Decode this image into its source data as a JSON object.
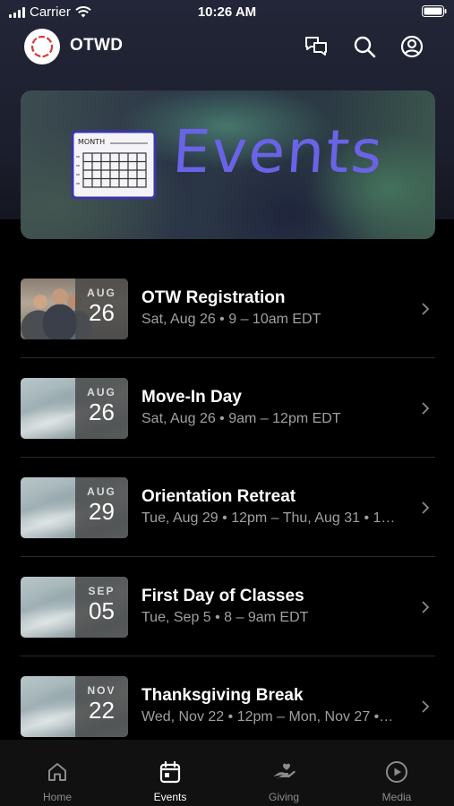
{
  "status_bar": {
    "carrier": "Carrier",
    "time": "10:26 AM"
  },
  "header": {
    "app_name": "OTWD"
  },
  "banner": {
    "calendar_label": "MONTH",
    "title": "Events"
  },
  "events": [
    {
      "month": "AUG",
      "day": "26",
      "title": "OTW Registration",
      "time": "Sat, Aug 26 • 9 – 10am EDT",
      "thumb": "photo"
    },
    {
      "month": "AUG",
      "day": "26",
      "title": "Move-In Day",
      "time": "Sat, Aug 26 • 9am – 12pm EDT",
      "thumb": "water"
    },
    {
      "month": "AUG",
      "day": "29",
      "title": "Orientation Retreat",
      "time": "Tue, Aug 29 • 12pm – Thu, Aug 31 • 1…",
      "thumb": "water"
    },
    {
      "month": "SEP",
      "day": "05",
      "title": "First Day of Classes",
      "time": "Tue, Sep 5 • 8 – 9am EDT",
      "thumb": "water"
    },
    {
      "month": "NOV",
      "day": "22",
      "title": "Thanksgiving Break",
      "time": "Wed, Nov 22 • 12pm – Mon, Nov 27 •…",
      "thumb": "water"
    }
  ],
  "tabs": [
    {
      "label": "Home",
      "icon": "home-icon",
      "active": false
    },
    {
      "label": "Events",
      "icon": "calendar-icon",
      "active": true
    },
    {
      "label": "Giving",
      "icon": "giving-hand-icon",
      "active": false
    },
    {
      "label": "Media",
      "icon": "play-icon",
      "active": false
    }
  ],
  "colors": {
    "accent_purple": "#6b63e6",
    "tab_active": "#ffffff",
    "tab_inactive": "#8c8c8c"
  }
}
